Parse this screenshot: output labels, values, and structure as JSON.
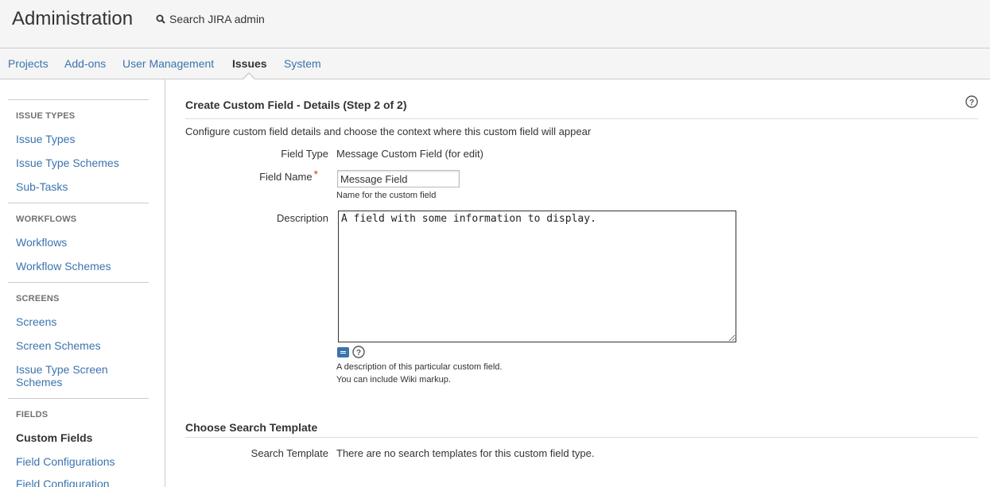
{
  "header": {
    "title": "Administration",
    "search_label": "Search JIRA admin"
  },
  "nav": {
    "items": [
      {
        "label": "Projects"
      },
      {
        "label": "Add-ons"
      },
      {
        "label": "User Management"
      },
      {
        "label": "Issues",
        "active": true
      },
      {
        "label": "System"
      }
    ]
  },
  "sidebar": {
    "sections": [
      {
        "heading": "ISSUE TYPES",
        "items": [
          "Issue Types",
          "Issue Type Schemes",
          "Sub-Tasks"
        ]
      },
      {
        "heading": "WORKFLOWS",
        "items": [
          "Workflows",
          "Workflow Schemes"
        ]
      },
      {
        "heading": "SCREENS",
        "items": [
          "Screens",
          "Screen Schemes",
          "Issue Type Screen Schemes"
        ]
      },
      {
        "heading": "FIELDS",
        "items": [
          "Custom Fields",
          "Field Configurations",
          "Field Configuration"
        ]
      }
    ],
    "active_item": "Custom Fields"
  },
  "main": {
    "title": "Create Custom Field - Details (Step 2 of 2)",
    "intro": "Configure custom field details and choose the context where this custom field will appear",
    "field_type": {
      "label": "Field Type",
      "value": "Message Custom Field (for edit)"
    },
    "field_name": {
      "label": "Field Name",
      "required_marker": "*",
      "value": "Message Field",
      "hint": "Name for the custom field"
    },
    "description": {
      "label": "Description",
      "value": "A field with some information to display.",
      "hint_line1": "A description of this particular custom field.",
      "hint_line2": "You can include Wiki markup."
    }
  },
  "search_template": {
    "title": "Choose Search Template",
    "label": "Search Template",
    "value": "There are no search templates for this custom field type."
  },
  "colors": {
    "link": "#3b73af",
    "required": "#d04437",
    "header_bg": "#f5f5f5"
  }
}
